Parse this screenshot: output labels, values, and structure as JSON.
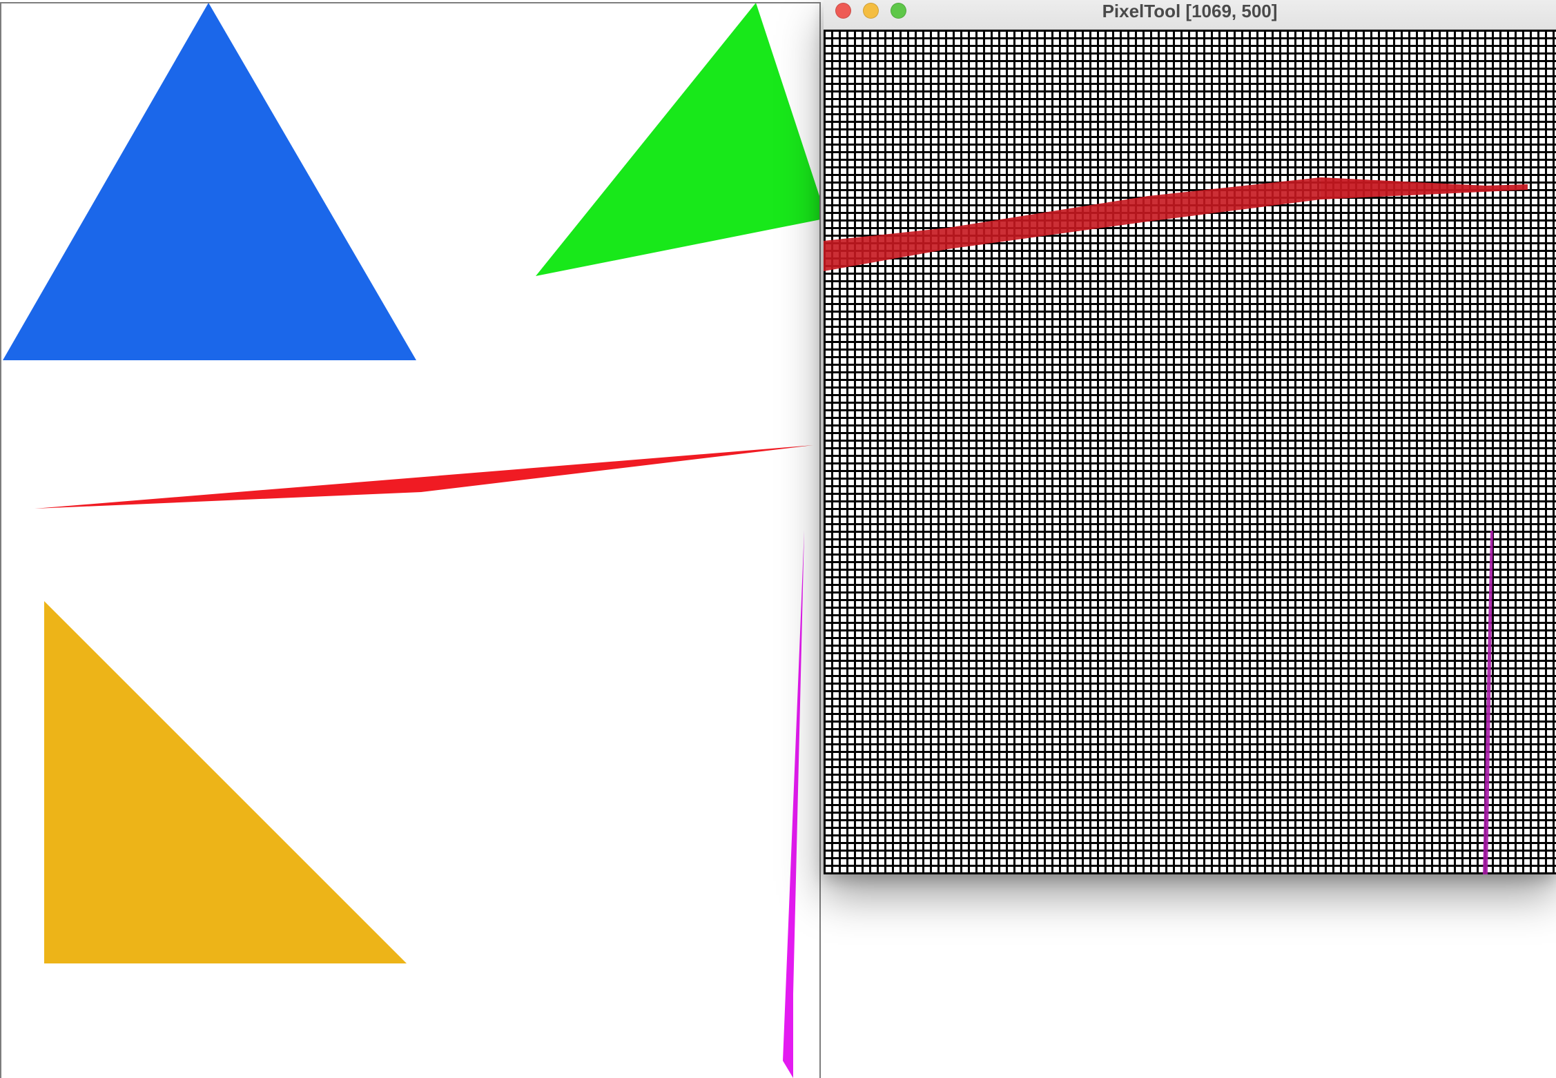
{
  "canvas": {
    "shapes": [
      {
        "name": "blue-triangle",
        "color": "#1b67ea"
      },
      {
        "name": "green-triangle",
        "color": "#18e81a"
      },
      {
        "name": "red-sliver-triangle",
        "color": "#f01b23"
      },
      {
        "name": "yellow-triangle",
        "color": "#edb418"
      },
      {
        "name": "magenta-sliver-triangle",
        "color": "#e31bf0"
      }
    ]
  },
  "pixeltool": {
    "title": "PixelTool [1069, 500]",
    "buttons": {
      "close": {
        "color": "#ee5b55"
      },
      "minimize": {
        "color": "#f4bd41"
      },
      "zoom": {
        "color": "#5ec749"
      }
    },
    "grid_color": "#000000",
    "magnified_red": "#c61820",
    "magnified_magenta": "#a91aa9"
  }
}
